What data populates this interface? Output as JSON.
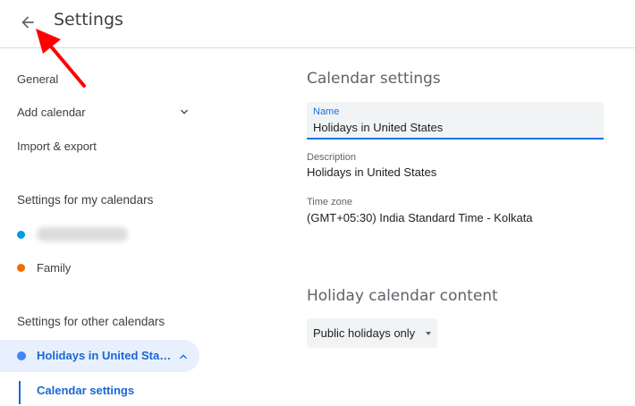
{
  "header": {
    "title": "Settings",
    "back_icon": "arrow-back-icon",
    "annotation_color": "#ff0000"
  },
  "sidebar": {
    "general": "General",
    "add_calendar": "Add calendar",
    "import_export": "Import & export",
    "my_calendars_heading": "Settings for my calendars",
    "my_calendars": [
      {
        "label": "",
        "color": "#039be5",
        "blurred": true
      },
      {
        "label": "Family",
        "color": "#ef6c00"
      }
    ],
    "other_calendars_heading": "Settings for other calendars",
    "selected_calendar": {
      "label": "Holidays in United Sta…",
      "color": "#4285f4"
    },
    "sub_item": "Calendar settings"
  },
  "main": {
    "calendar_settings_heading": "Calendar settings",
    "name_label": "Name",
    "name_value": "Holidays in United States",
    "description_label": "Description",
    "description_value": "Holidays in United States",
    "timezone_label": "Time zone",
    "timezone_value": "(GMT+05:30) India Standard Time - Kolkata",
    "holiday_content_heading": "Holiday calendar content",
    "holiday_content_select": "Public holidays only"
  },
  "colors": {
    "accent": "#1a73e8",
    "selected_bg": "#e8f0fe",
    "selected_text": "#1967d2"
  }
}
